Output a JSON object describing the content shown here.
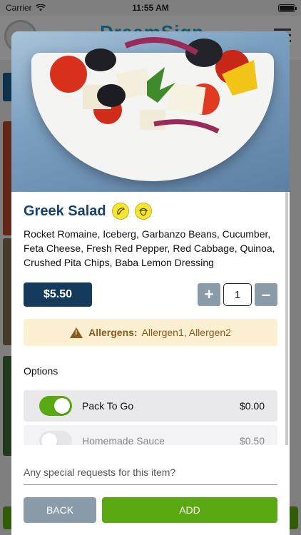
{
  "status_bar": {
    "carrier": "Carrier",
    "time": "11:55 AM"
  },
  "background_app": {
    "brand": "DreamSign"
  },
  "item": {
    "name": "Greek Salad",
    "diet_icons": [
      "pepper-icon",
      "acorn-icon"
    ],
    "description": "Rocket Romaine, Iceberg, Garbanzo Beans, Cucumber, Feta Cheese, Fresh Red Pepper, Red Cabbage, Quinoa, Crushed Pita Chips, Baba Lemon Dressing",
    "price": "$5.50",
    "quantity": "1"
  },
  "quantity_controls": {
    "increase": "+",
    "decrease": "–"
  },
  "allergens": {
    "label": "Allergens:",
    "values": "Allergen1,  Allergen2"
  },
  "options": {
    "label": "Options",
    "items": [
      {
        "name": "Pack To Go",
        "price": "$0.00",
        "enabled": true
      },
      {
        "name": "Homemade Sauce",
        "price": "$0.50",
        "enabled": false
      }
    ]
  },
  "special_requests": {
    "placeholder": "Any special requests for this item?"
  },
  "actions": {
    "back": "BACK",
    "add": "ADD"
  },
  "colors": {
    "navy": "#143a5c",
    "green": "#5aa912",
    "gray_button": "#8a9baa",
    "allergen_bg": "#fdefd2",
    "allergen_text": "#8a5a1a"
  }
}
